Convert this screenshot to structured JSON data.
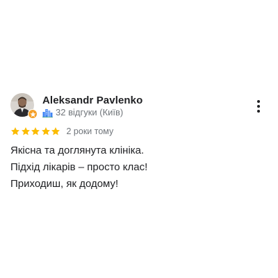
{
  "review": {
    "reviewer_name": "Aleksandr Pavlenko",
    "reviewer_meta": "32 відгуки (Київ)",
    "rating": 5,
    "rating_max": 5,
    "date": "2 роки тому",
    "text_lines": [
      "Якісна та доглянута клініка.",
      "Підхід лікарів – просто клас!",
      "Приходиш, як додому!"
    ]
  },
  "colors": {
    "star": "#fbbc04",
    "badge": "#f4a02a",
    "meta_icon": "#4285f4",
    "secondary_text": "#70757a"
  },
  "icons": {
    "avatar": "reviewer-photo",
    "badge": "local-guide-badge-icon",
    "meta": "city-buildings-icon",
    "more": "more-vert-icon",
    "star": "star-icon"
  }
}
